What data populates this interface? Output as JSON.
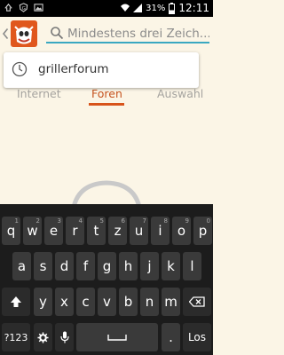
{
  "status_bar": {
    "battery": "31%",
    "time": "12:11"
  },
  "search": {
    "placeholder": "Mindestens drei Zeich..."
  },
  "tabs": [
    {
      "label": "Internet"
    },
    {
      "label": "Foren"
    },
    {
      "label": "Auswahl"
    }
  ],
  "suggestions": [
    {
      "label": "grillerforum"
    }
  ],
  "keyboard": {
    "row1": [
      {
        "label": "q",
        "alt": "1"
      },
      {
        "label": "w",
        "alt": "2"
      },
      {
        "label": "e",
        "alt": "3"
      },
      {
        "label": "r",
        "alt": "4"
      },
      {
        "label": "t",
        "alt": "5"
      },
      {
        "label": "z",
        "alt": "6"
      },
      {
        "label": "u",
        "alt": "7"
      },
      {
        "label": "i",
        "alt": "8"
      },
      {
        "label": "o",
        "alt": "9"
      },
      {
        "label": "p",
        "alt": "0"
      }
    ],
    "row2": [
      {
        "label": "a"
      },
      {
        "label": "s"
      },
      {
        "label": "d"
      },
      {
        "label": "f"
      },
      {
        "label": "g"
      },
      {
        "label": "h"
      },
      {
        "label": "j"
      },
      {
        "label": "k"
      },
      {
        "label": "l"
      }
    ],
    "row3": [
      {
        "label": "y"
      },
      {
        "label": "x"
      },
      {
        "label": "c"
      },
      {
        "label": "v"
      },
      {
        "label": "b"
      },
      {
        "label": "n"
      },
      {
        "label": "m"
      }
    ],
    "symbols_label": "?123",
    "period_label": ".",
    "go_label": "Los"
  },
  "colors": {
    "accent": "#d8541b",
    "search_underline": "#3aa8c1"
  }
}
